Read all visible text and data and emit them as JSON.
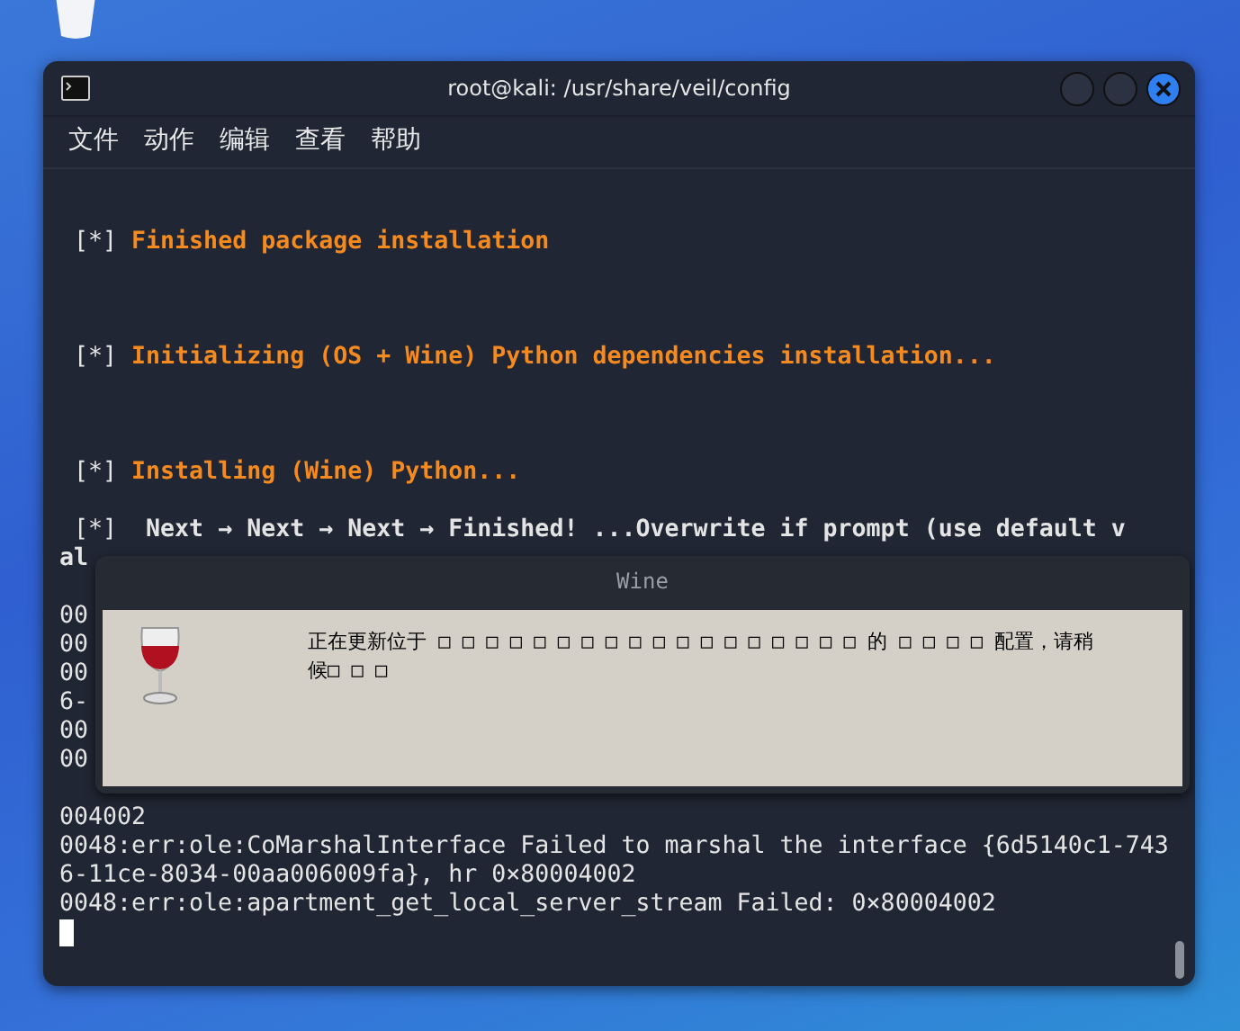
{
  "window": {
    "title": "root@kali: /usr/share/veil/config"
  },
  "menu": [
    "文件",
    "动作",
    "编辑",
    "查看",
    "帮助"
  ],
  "terminal": {
    "lines": [
      {
        "kind": "blank"
      },
      {
        "kind": "blank"
      },
      {
        "kind": "status",
        "prefix": "[*]",
        "text": "Finished package installation"
      },
      {
        "kind": "blank"
      },
      {
        "kind": "blank"
      },
      {
        "kind": "blank"
      },
      {
        "kind": "status",
        "prefix": "[*]",
        "text": "Initializing (OS + Wine) Python dependencies installation..."
      },
      {
        "kind": "blank"
      },
      {
        "kind": "blank"
      },
      {
        "kind": "blank"
      },
      {
        "kind": "status",
        "prefix": "[*]",
        "text": "Installing (Wine) Python..."
      },
      {
        "kind": "blank"
      },
      {
        "kind": "bold",
        "prefix": "[*]",
        "text": " Next → Next → Next → Finished! ...Overwrite if prompt (use default v"
      },
      {
        "kind": "bold",
        "text": "al"
      },
      {
        "kind": "hidden"
      },
      {
        "kind": "plain",
        "text": "00"
      },
      {
        "kind": "plain",
        "text": "00"
      },
      {
        "kind": "plain",
        "text": "00"
      },
      {
        "kind": "plain",
        "text": "6-"
      },
      {
        "kind": "plain",
        "text": "00"
      },
      {
        "kind": "plain",
        "text": "00"
      },
      {
        "kind": "hidden"
      },
      {
        "kind": "plain",
        "text": "004002"
      },
      {
        "kind": "plain",
        "text": "0048:err:ole:CoMarshalInterface Failed to marshal the interface {6d5140c1-743"
      },
      {
        "kind": "plain",
        "text": "6-11ce-8034-00aa006009fa}, hr 0×80004002"
      },
      {
        "kind": "plain",
        "text": "0048:err:ole:apartment_get_local_server_stream Failed: 0×80004002"
      },
      {
        "kind": "cursor"
      }
    ]
  },
  "dialog": {
    "title": "Wine",
    "message": "正在更新位于 □ □ □ □ □ □ □ □ □ □ □ □ □ □ □ □ □ □ 的 □ □ □ □ 配置，请稍候□ □ □"
  }
}
